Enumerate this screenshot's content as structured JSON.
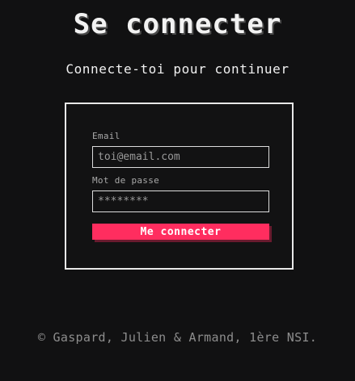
{
  "header": {
    "title": "Se connecter",
    "subtitle": "Connecte-toi pour continuer"
  },
  "form": {
    "email_label": "Email",
    "email_placeholder": "toi@email.com",
    "password_label": "Mot de passe",
    "password_placeholder": "********",
    "submit_label": "Me connecter"
  },
  "footer": {
    "credits": "© Gaspard, Julien & Armand, 1ère NSI."
  },
  "colors": {
    "background": "#111112",
    "accent": "#ff2d5f",
    "border": "#e8e8e8",
    "muted": "#8d8d8d"
  }
}
